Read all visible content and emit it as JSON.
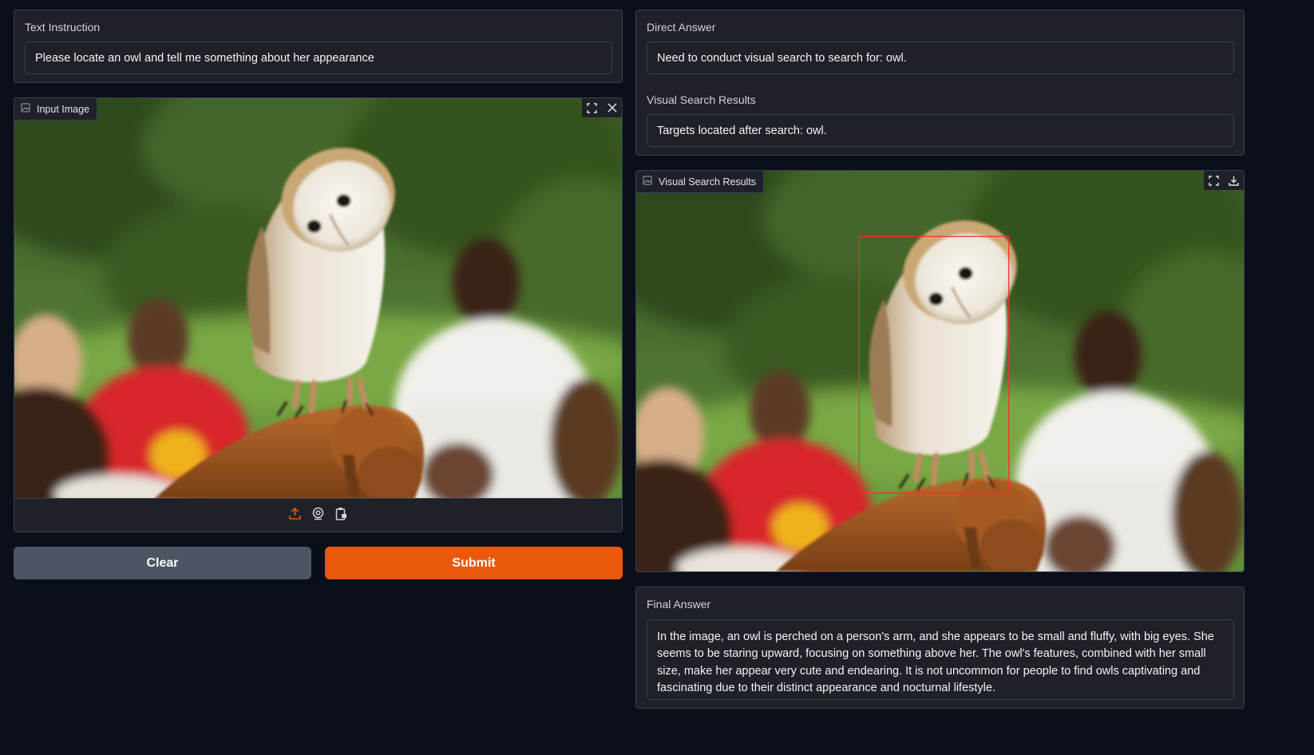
{
  "text_instruction": {
    "label": "Text Instruction",
    "value": "Please locate an owl and tell me something about her appearance"
  },
  "input_image": {
    "label": "Input Image",
    "fullscreen_icon": "fullscreen-icon",
    "clear_icon": "close-icon",
    "upload_icon": "upload-icon",
    "webcam_icon": "webcam-icon",
    "clipboard_icon": "clipboard-icon"
  },
  "buttons": {
    "clear": "Clear",
    "submit": "Submit"
  },
  "direct_answer": {
    "label": "Direct Answer",
    "value": "Need to conduct visual search to search for: owl."
  },
  "visual_search_text": {
    "label": "Visual Search Results",
    "value": "Targets located after search: owl."
  },
  "visual_search_image": {
    "label": "Visual Search Results",
    "fullscreen_icon": "fullscreen-icon",
    "download_icon": "download-icon"
  },
  "final_answer": {
    "label": "Final Answer",
    "value": "In the image, an owl is perched on a person's arm, and she appears to be small and fluffy, with big eyes. She seems to be staring upward, focusing on something above her. The owl's features, combined with her small size, make her appear very cute and endearing. It is not uncommon for people to find owls captivating and fascinating due to their distinct appearance and nocturnal lifestyle."
  },
  "colors": {
    "accent": "#ea580c",
    "secondary_button": "#4b5563",
    "page_background": "#0b0f19",
    "panel_background": "#1f2128",
    "border": "#374151",
    "bounding_box": "#ff2a2a"
  }
}
